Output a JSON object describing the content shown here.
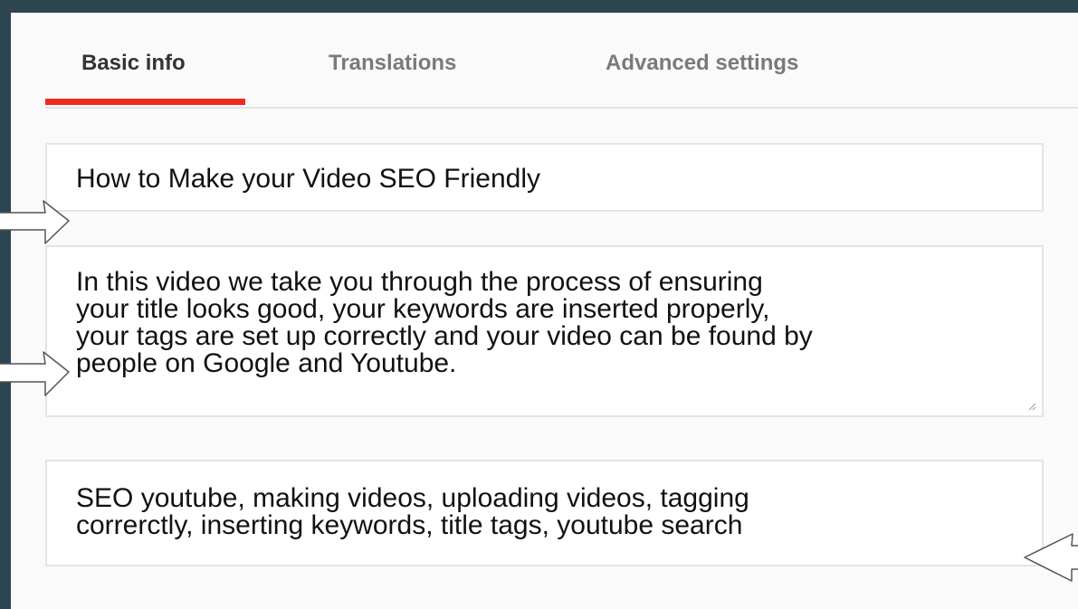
{
  "tabs": [
    {
      "label": "Basic info",
      "active": true
    },
    {
      "label": "Translations",
      "active": false
    },
    {
      "label": "Advanced settings",
      "active": false
    }
  ],
  "form": {
    "title": "How to Make your Video SEO Friendly",
    "description": "In this video we take you through the process of ensuring\nyour title looks good, your keywords are inserted properly,\nyour tags are set up correctly and your video can be found by\npeople on Google and Youtube.",
    "tags": "SEO youtube, making videos, uploading videos, tagging\ncorrerctly, inserting keywords, title tags, youtube search"
  },
  "colors": {
    "background": "#2c4550",
    "panel": "#fafafa",
    "active_tab_indicator": "#ee2b1f",
    "field_border": "#e4e4e4"
  },
  "icons": {
    "pointer_arrows": "arrow-right-icon, arrow-left-icon"
  }
}
